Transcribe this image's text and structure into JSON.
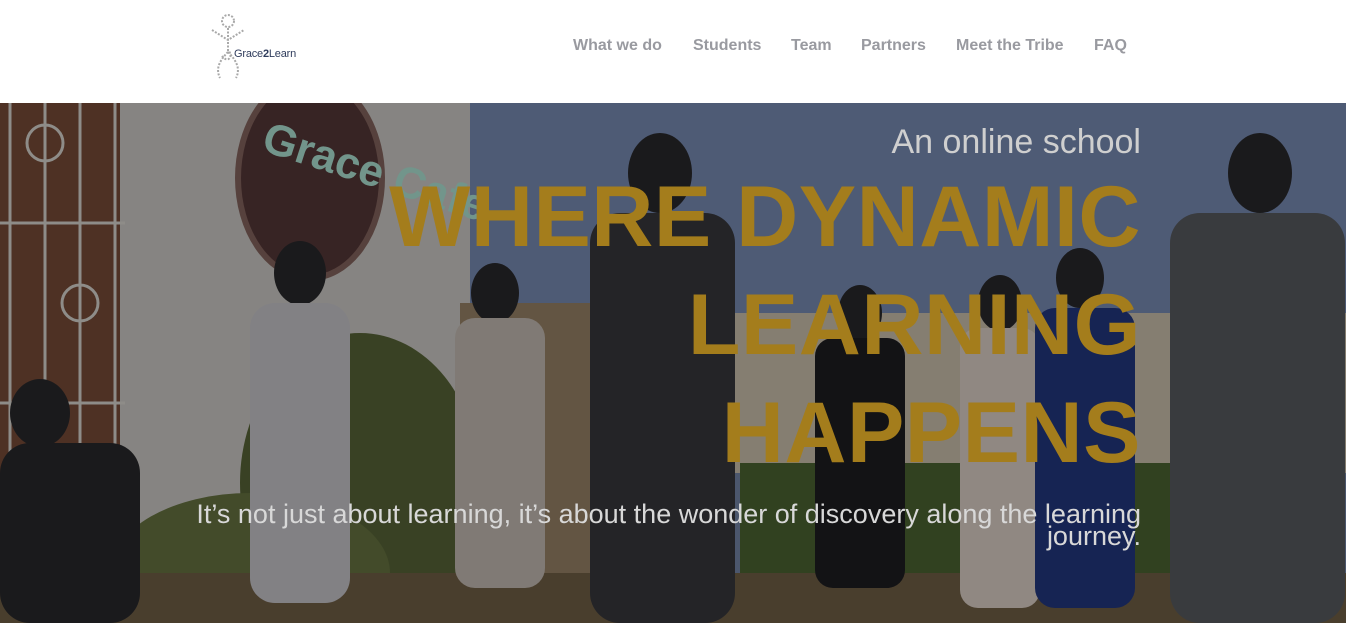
{
  "brand": {
    "name_prefix": "Grace",
    "name_bold": "2",
    "name_suffix": "Learn",
    "icon": "ribbon-figure-logo"
  },
  "nav": {
    "items": [
      {
        "label": "What we do"
      },
      {
        "label": "Students"
      },
      {
        "label": "Team"
      },
      {
        "label": "Partners"
      },
      {
        "label": "Meet the Tribe"
      },
      {
        "label": "FAQ"
      }
    ]
  },
  "hero": {
    "eyebrow": "An online school",
    "headline": "WHERE DYNAMIC LEARNING HAPPENS",
    "tagline": "It’s not just about learning, it’s about the wonder of discovery along the learning journey.",
    "sign_text": "Grace Cafe"
  },
  "colors": {
    "nav_text": "#999aa0",
    "headline": "#a47d1c",
    "header_bg": "#ffffff"
  }
}
